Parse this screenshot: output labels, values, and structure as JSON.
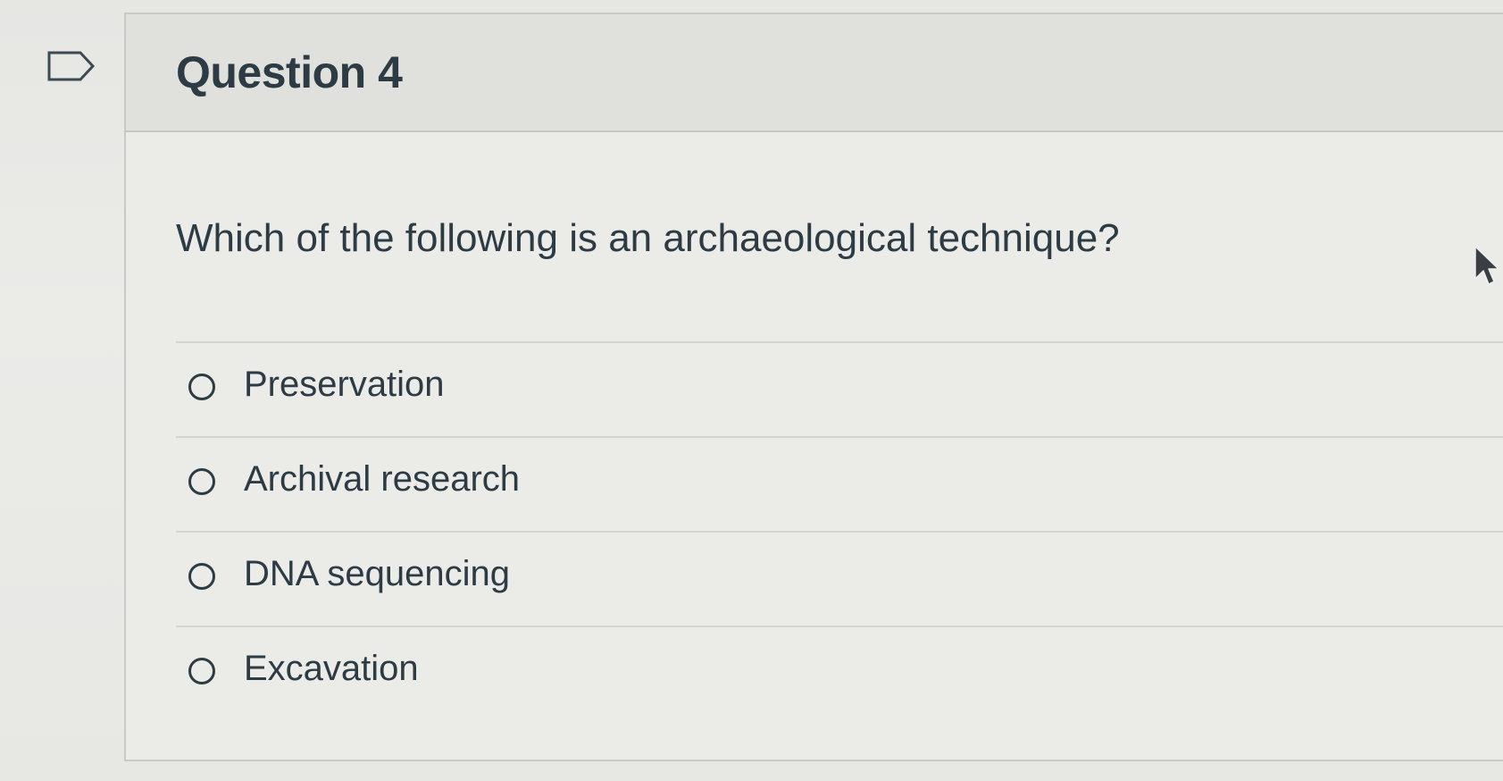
{
  "question": {
    "flag_icon": "flag-outline-icon",
    "title": "Question 4",
    "text": "Which of the following is an archaeological technique?",
    "answers": [
      {
        "label": "Preservation",
        "selected": false
      },
      {
        "label": "Archival research",
        "selected": false
      },
      {
        "label": "DNA sequencing",
        "selected": false
      },
      {
        "label": "Excavation",
        "selected": false
      }
    ]
  },
  "colors": {
    "text": "#2d3b45",
    "header_bg": "#e0e0dd",
    "page_bg": "#e9e9e6",
    "divider": "#d4d4d1"
  }
}
